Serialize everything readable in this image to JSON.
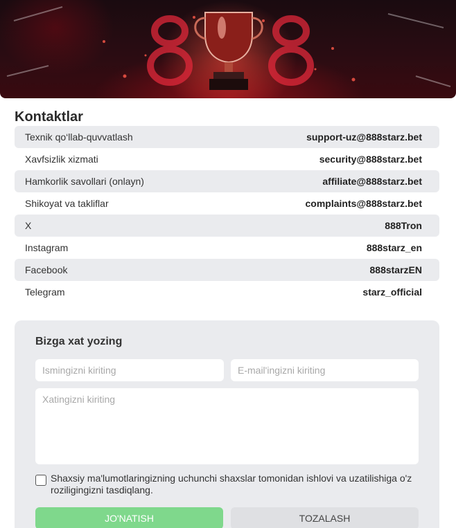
{
  "contacts": {
    "title": "Kontaktlar",
    "rows": [
      {
        "label": "Texnik qo‘llab-quvvatlash",
        "value": "support-uz@888starz.bet"
      },
      {
        "label": "Xavfsizlik xizmati",
        "value": "security@888starz.bet"
      },
      {
        "label": "Hamkorlik savollari (onlayn)",
        "value": "affiliate@888starz.bet"
      },
      {
        "label": "Shikoyat va takliflar",
        "value": "complaints@888starz.bet"
      },
      {
        "label": "X",
        "value": "888Tron"
      },
      {
        "label": "Instagram",
        "value": "888starz_en"
      },
      {
        "label": "Facebook",
        "value": "888starzEN"
      },
      {
        "label": "Telegram",
        "value": "starz_official"
      }
    ]
  },
  "form": {
    "title": "Bizga xat yozing",
    "name_placeholder": "Ismingizni kiriting",
    "email_placeholder": "E-mail'ingizni kiriting",
    "message_placeholder": "Xatingizni kiriting",
    "consent_text": "Shaxsiy ma'lumotlaringizning uchunchi shaxslar tomonidan ishlovi va uzatilishiga o'z roziligingizni tasdiqlang.",
    "submit_label": "JO'NATISH",
    "clear_label": "TOZALASH"
  },
  "colors": {
    "submit": "#7fd88c",
    "row_shade": "#eaebee"
  }
}
